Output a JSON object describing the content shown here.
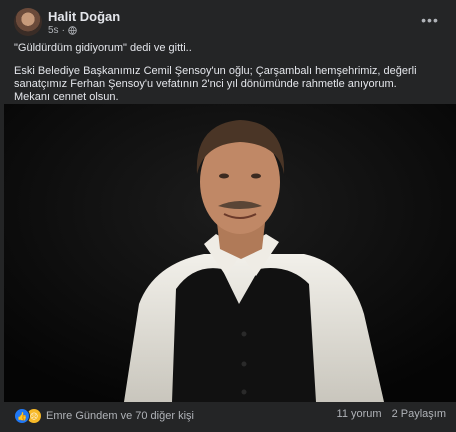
{
  "post": {
    "author": "Halit Doğan",
    "time": "5s",
    "privacy_icon": "globe-icon",
    "more_icon": "ellipsis-icon",
    "text_lines": [
      "\"Güldürdüm gidiyorum\" dedi ve gitti..",
      "Eski Belediye Başkanımız Cemil Şensoy'un oğlu; Çarşambalı hemşehrimiz, değerli sanatçımız Ferhan Şensoy'u vefatının 2'nci yıl dönümünde rahmetle anıyorum.",
      "Mekanı cennet olsun."
    ]
  },
  "reactions": {
    "icons": [
      "like-icon",
      "sad-icon"
    ],
    "names": "Emre Gündem ve 70 diğer kişi",
    "comments": "11 yorum",
    "shares": "2 Paylaşım"
  },
  "colors": {
    "background": "#242526",
    "text": "#e4e6eb",
    "secondary_text": "#b0b3b8",
    "like": "#2078f4",
    "sad": "#f7b928"
  }
}
